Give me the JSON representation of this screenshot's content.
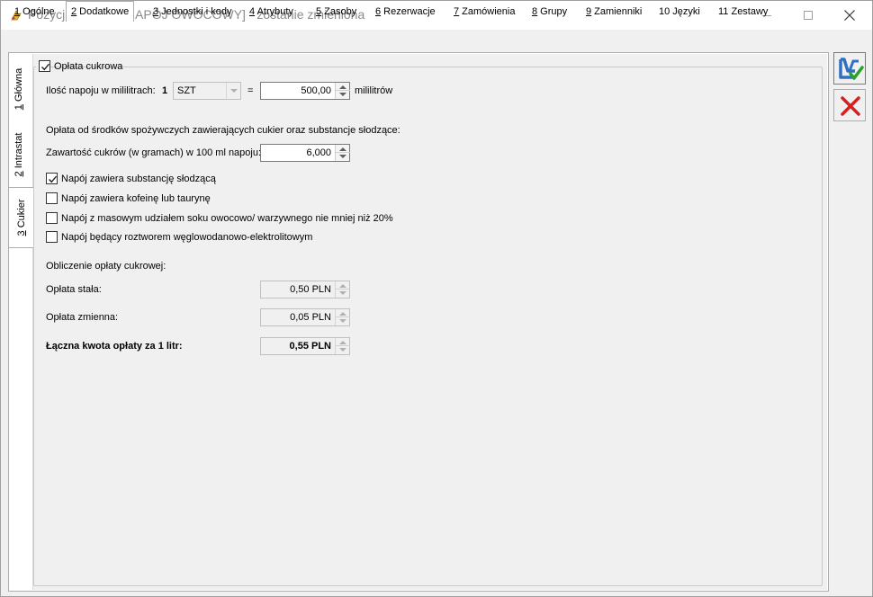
{
  "window": {
    "title": "Pozycja cennika [NAPÓJ OWOCOWY] - zostanie zmieniona"
  },
  "tabs": [
    {
      "key": "1",
      "label": " Ogólne"
    },
    {
      "key": "2",
      "label": " Dodatkowe"
    },
    {
      "key": "3",
      "label": " Jednostki i kody"
    },
    {
      "key": "4",
      "label": " Atrybuty"
    },
    {
      "key": "5",
      "label": " Zasoby"
    },
    {
      "key": "6",
      "label": " Rezerwacje"
    },
    {
      "key": "7",
      "label": " Zamówienia"
    },
    {
      "key": "8",
      "label": " Grupy"
    },
    {
      "key": "9",
      "label": " Zamienniki"
    },
    {
      "key": "",
      "label": "10 Języki"
    },
    {
      "key": "",
      "label": "11 Zestawy"
    }
  ],
  "active_tab": "2 Dodatkowe",
  "side_tabs": [
    {
      "key": "1",
      "label": " Główna"
    },
    {
      "key": "2",
      "label": " Intrastat"
    },
    {
      "key": "3",
      "label": " Cukier"
    }
  ],
  "sugar": {
    "group_label": "Opłata cukrowa",
    "group_checked": true,
    "volume_label": "Ilość napoju w mililitrach:",
    "volume_qty": "1",
    "unit": "SZT",
    "equals": "=",
    "volume_value": "500,00",
    "volume_unit": "mililitrów",
    "desc": "Opłata od środków spożywczych zawierających cukier oraz substancje słodzące:",
    "sugar_content_label": "Zawartość cukrów (w gramach) w 100 ml napoju:",
    "sugar_content_value": "6,000",
    "checkboxes": [
      {
        "label": "Napój zawiera substancję słodzącą",
        "checked": true
      },
      {
        "label": "Napój zawiera kofeinę lub taurynę",
        "checked": false
      },
      {
        "label": "Napój z masowym udziałem soku owocowo/ warzywnego nie mniej niż 20%",
        "checked": false
      },
      {
        "label": "Napój będący roztworem węglowodanowo-elektrolitowym",
        "checked": false
      }
    ],
    "calc_label": "Obliczenie opłaty cukrowej:",
    "fixed_fee_label": "Opłata stała:",
    "fixed_fee_value": "0,50 PLN",
    "variable_fee_label": "Opłata zmienna:",
    "variable_fee_value": "0,05 PLN",
    "total_label": "Łączna kwota opłaty za 1 litr:",
    "total_value": "0,55 PLN"
  },
  "colors": {
    "save_blue": "#2f6fc4",
    "check_green": "#2aa02a",
    "cancel_red": "#d42020"
  },
  "icons": {
    "app": "app-icon",
    "save": "save-icon",
    "cancel": "cancel-icon"
  }
}
